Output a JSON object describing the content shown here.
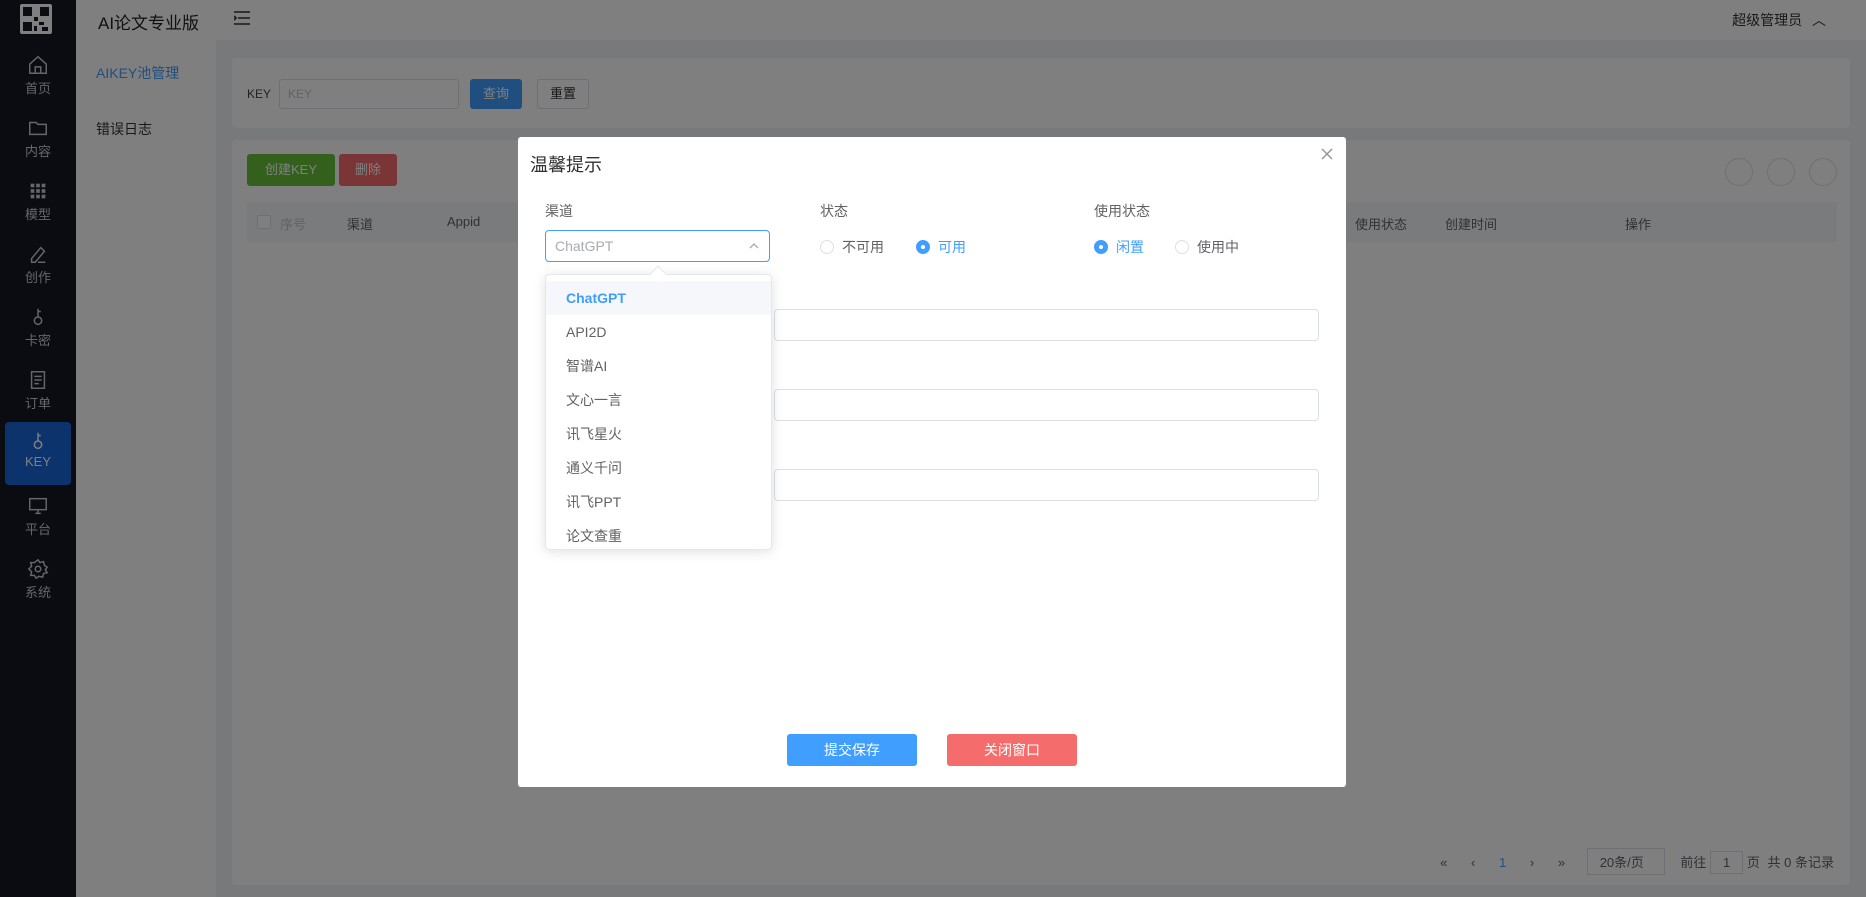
{
  "app": {
    "title": "AI论文专业版",
    "user": "超级管理员"
  },
  "rail": [
    {
      "label": "首页",
      "icon": "home-icon"
    },
    {
      "label": "内容",
      "icon": "folder-icon"
    },
    {
      "label": "模型",
      "icon": "grid-icon"
    },
    {
      "label": "创作",
      "icon": "pen-icon"
    },
    {
      "label": "卡密",
      "icon": "key-icon"
    },
    {
      "label": "订单",
      "icon": "document-icon"
    },
    {
      "label": "KEY",
      "icon": "key-icon",
      "active": true
    },
    {
      "label": "平台",
      "icon": "monitor-icon"
    },
    {
      "label": "系统",
      "icon": "gear-icon"
    }
  ],
  "sidebar": {
    "items": [
      {
        "label": "AIKEY池管理",
        "active": true
      },
      {
        "label": "错误日志"
      }
    ]
  },
  "search": {
    "label": "KEY",
    "placeholder": "KEY",
    "query_label": "查询",
    "reset_label": "重置"
  },
  "toolbar": {
    "create_label": "创建KEY",
    "delete_label": "删除"
  },
  "table": {
    "columns": [
      "序号",
      "渠道",
      "Appid",
      "使用状态",
      "创建时间",
      "操作"
    ]
  },
  "pagination": {
    "page_size": "20条/页",
    "goto_label": "前往",
    "page": "1",
    "page_unit": "页",
    "total": "共 0 条记录",
    "current": "1"
  },
  "dialog": {
    "title": "温馨提示",
    "channel_label": "渠道",
    "channel_value": "ChatGPT",
    "status_label": "状态",
    "status_options": [
      "不可用",
      "可用"
    ],
    "status_selected": "可用",
    "usage_label": "使用状态",
    "usage_options": [
      "闲置",
      "使用中"
    ],
    "usage_selected": "闲置",
    "submit_label": "提交保存",
    "close_label": "关闭窗口"
  },
  "dropdown": {
    "options": [
      "ChatGPT",
      "API2D",
      "智谱AI",
      "文心一言",
      "讯飞星火",
      "通义千问",
      "讯飞PPT",
      "论文查重"
    ],
    "selected": "ChatGPT"
  },
  "colors": {
    "primary": "#409eff",
    "success": "#67c23a",
    "danger": "#f56c6c",
    "rail": "#141824",
    "rail_active": "#1966d8"
  }
}
